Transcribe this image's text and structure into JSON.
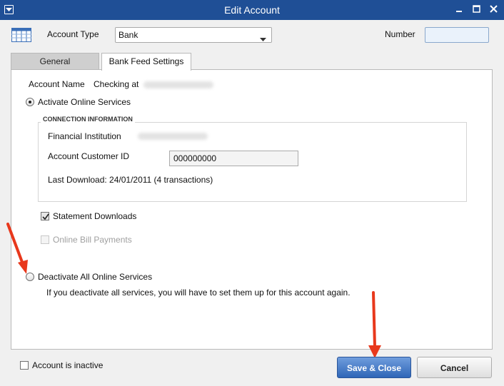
{
  "window": {
    "title": "Edit Account"
  },
  "header": {
    "account_type_label": "Account Type",
    "account_type_value": "Bank",
    "number_label": "Number",
    "number_value": ""
  },
  "tabs": [
    {
      "label": "General",
      "active": false
    },
    {
      "label": "Bank Feed Settings",
      "active": true
    }
  ],
  "bank_feed": {
    "account_name_label": "Account Name",
    "account_name_value": "Checking at",
    "activate_label": "Activate Online Services",
    "activate_selected": true,
    "connection_group_title": "CONNECTION INFORMATION",
    "financial_institution_label": "Financial Institution",
    "customer_id_label": "Account Customer ID",
    "customer_id_value": "000000000",
    "last_download": "Last Download: 24/01/2011 (4 transactions)",
    "statement_downloads_label": "Statement Downloads",
    "statement_downloads_checked": true,
    "bill_payments_label": "Online Bill Payments",
    "bill_payments_checked": false,
    "deactivate_label": "Deactivate All Online Services",
    "deactivate_selected": false,
    "deactivate_note": "If you deactivate all services, you will have to set them up for this account again."
  },
  "footer": {
    "inactive_label": "Account is inactive",
    "inactive_checked": false,
    "save_close_label": "Save & Close",
    "cancel_label": "Cancel"
  },
  "colors": {
    "titlebar": "#1f4f96",
    "primary_button": "#2f66b7",
    "annotation_arrow": "#e8381c"
  },
  "icons": [
    "system-menu-icon",
    "minimize-icon",
    "maximize-icon",
    "close-icon",
    "account-register-icon",
    "chevron-down-icon",
    "checkmark-icon",
    "annotation-arrow-icon"
  ]
}
